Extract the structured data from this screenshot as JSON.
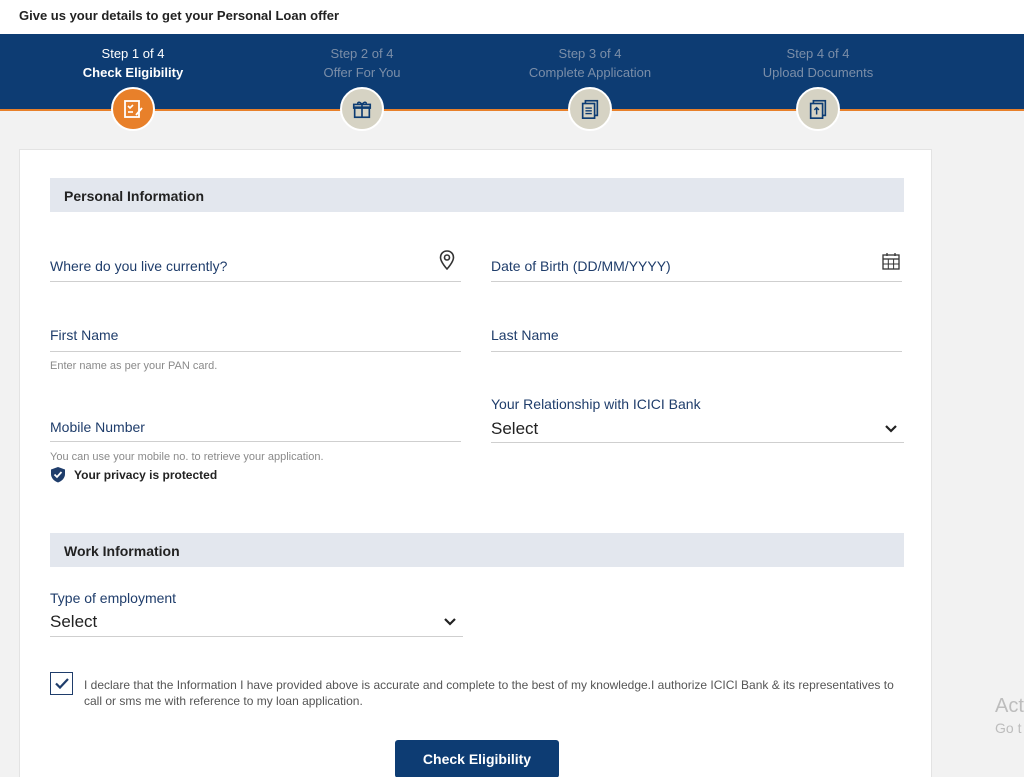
{
  "header": {
    "title": "Give us your details to get your Personal Loan offer"
  },
  "steps": [
    {
      "number": "Step 1 of 4",
      "label": "Check Eligibility",
      "icon": "checklist-icon",
      "active": true
    },
    {
      "number": "Step 2 of 4",
      "label": "Offer For You",
      "icon": "gift-icon",
      "active": false
    },
    {
      "number": "Step 3 of 4",
      "label": "Complete Application",
      "icon": "document-icon",
      "active": false
    },
    {
      "number": "Step 4 of 4",
      "label": "Upload Documents",
      "icon": "upload-document-icon",
      "active": false
    }
  ],
  "colors": {
    "brand_navy": "#0d3c73",
    "accent_orange": "#e8802a",
    "label_blue": "#1f3d6b",
    "section_bg": "#e3e7ee"
  },
  "personal": {
    "heading": "Personal Information",
    "location_label": "Where do you live currently?",
    "dob_label": "Date of Birth (DD/MM/YYYY)",
    "first_name_label": "First Name",
    "first_name_helper": "Enter name as per your PAN card.",
    "last_name_label": "Last Name",
    "mobile_label": "Mobile Number",
    "mobile_helper": "You can use your mobile no. to retrieve your application.",
    "privacy_text": "Your privacy is protected",
    "relationship_label": "Your Relationship with ICICI Bank",
    "relationship_value": "Select"
  },
  "work": {
    "heading": "Work Information",
    "employment_label": "Type of employment",
    "employment_value": "Select"
  },
  "declaration": {
    "checked": true,
    "text": "I declare that the Information I have provided above is accurate and complete to the best of my knowledge.I authorize ICICI Bank & its representatives to call or sms me with reference to my loan application."
  },
  "cta": {
    "label": "Check Eligibility"
  },
  "watermark": {
    "line1": "Act",
    "line2": "Go t"
  }
}
